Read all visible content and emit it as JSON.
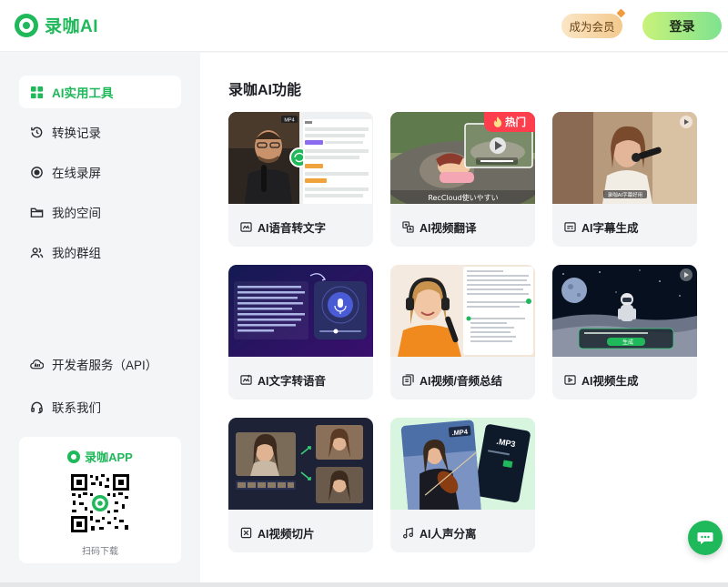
{
  "header": {
    "brand": "录咖AI",
    "vip_label": "成为会员",
    "login_label": "登录"
  },
  "sidebar": {
    "items": [
      {
        "label": "AI实用工具",
        "icon": "grid-icon",
        "active": true
      },
      {
        "label": "转换记录",
        "icon": "history-icon"
      },
      {
        "label": "在线录屏",
        "icon": "record-icon"
      },
      {
        "label": "我的空间",
        "icon": "folder-icon"
      },
      {
        "label": "我的群组",
        "icon": "group-icon"
      },
      {
        "label": "开发者服务（API）",
        "icon": "cloud-api-icon"
      },
      {
        "label": "联系我们",
        "icon": "headset-icon"
      }
    ],
    "app": {
      "title": "录咖APP",
      "scan_text": "扫码下载"
    }
  },
  "main": {
    "title": "录咖AI功能",
    "cards": [
      {
        "label": "AI语音转文字",
        "icon": "speech-to-text-icon",
        "thumb": "podcast-transcript"
      },
      {
        "label": "AI视频翻译",
        "icon": "translate-icon",
        "thumb": "anime-translate",
        "badge": "热门",
        "caption": "RecCloud使いやすい"
      },
      {
        "label": "AI字幕生成",
        "icon": "subtitle-icon",
        "thumb": "woman-mic",
        "caption": "录咖AI字幕好用"
      },
      {
        "label": "AI文字转语音",
        "icon": "text-to-speech-icon",
        "thumb": "tts-panel"
      },
      {
        "label": "AI视频/音频总结",
        "icon": "summary-icon",
        "thumb": "woman-headphones"
      },
      {
        "label": "AI视频生成",
        "icon": "video-gen-icon",
        "thumb": "astronaut-moon",
        "button": "生成"
      },
      {
        "label": "AI视频切片",
        "icon": "clip-icon",
        "thumb": "video-clips"
      },
      {
        "label": "AI人声分离",
        "icon": "music-note-icon",
        "thumb": "violin-mp3",
        "tags": [
          ".MP4",
          ".MP3"
        ]
      }
    ]
  },
  "colors": {
    "brand": "#1fb85a",
    "hot": "#ff3e4d"
  }
}
